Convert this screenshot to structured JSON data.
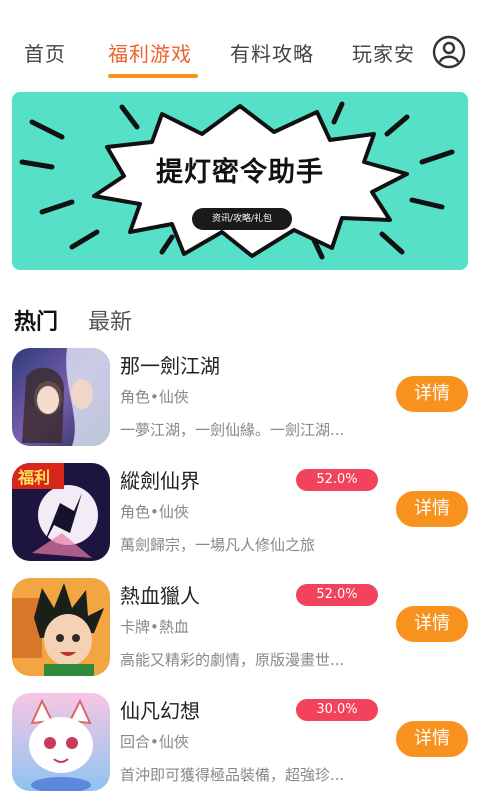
{
  "nav": {
    "tabs": [
      {
        "label": "首页"
      },
      {
        "label": "福利游戏"
      },
      {
        "label": "有料攻略"
      },
      {
        "label": "玩家安"
      }
    ],
    "active_index": 1
  },
  "banner": {
    "title": "提灯密令助手",
    "pill": "资讯/攻略/礼包"
  },
  "sections": {
    "hot": "热门",
    "latest": "最新"
  },
  "games": [
    {
      "name": "那一劍江湖",
      "tag": "角色•仙俠",
      "desc": "一夢江湖，一劍仙緣。一劍江湖...",
      "discount": "",
      "button": "详情"
    },
    {
      "name": "縱劍仙界",
      "tag": "角色•仙俠",
      "desc": "萬劍歸宗，一場凡人修仙之旅",
      "discount": "52.0%",
      "button": "详情",
      "badge": "福利"
    },
    {
      "name": "熱血獵人",
      "tag": "卡牌•熱血",
      "desc": "高能又精彩的劇情，原版漫畫世...",
      "discount": "52.0%",
      "button": "详情"
    },
    {
      "name": "仙凡幻想",
      "tag": "回合•仙俠",
      "desc": "首沖即可獲得極品裝備，超強珍...",
      "discount": "30.0%",
      "button": "详情"
    }
  ],
  "colors": {
    "accent": "#f0622d",
    "button": "#f7921f",
    "discount": "#f2425c",
    "banner_bg": "#56e0c8"
  }
}
